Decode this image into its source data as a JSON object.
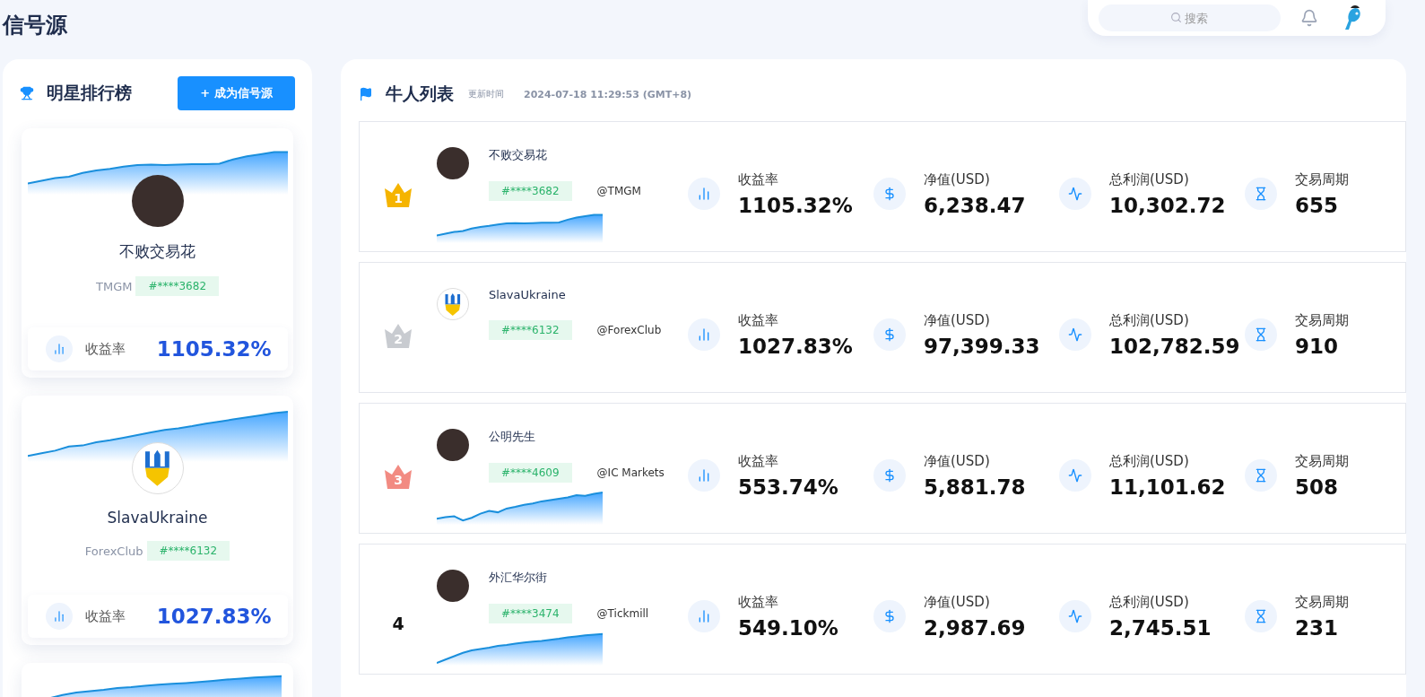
{
  "page_title": "信号源",
  "header": {
    "search": {
      "placeholder": "搜索"
    }
  },
  "star_board": {
    "title": "明星排行榜",
    "button": "+ 成为信号源",
    "cards": [
      {
        "name": "不败交易花",
        "broker": "TMGM",
        "account": "#****3682",
        "metric_label": "收益率",
        "metric_value": "1105.32%",
        "kind": "photo"
      },
      {
        "name": "SlavaUkraine",
        "broker": "ForexClub",
        "account": "#****6132",
        "metric_label": "收益率",
        "metric_value": "1027.83%",
        "kind": "emblem"
      }
    ]
  },
  "trader_list": {
    "title": "牛人列表",
    "updated_label": "更新时间",
    "updated_time": "2024-07-18 11:29:53 (GMT+8)",
    "rows": [
      {
        "rank": "1",
        "color": "#f5b400",
        "name": "不败交易花",
        "account": "#****3682",
        "broker": "@TMGM",
        "kind": "photo",
        "sparkline": true,
        "stats": [
          {
            "kind": "return",
            "label": "收益率",
            "value": "1105.32%"
          },
          {
            "kind": "equity",
            "label": "净值(USD)",
            "value": "6,238.47"
          },
          {
            "kind": "profit",
            "label": "总利润(USD)",
            "value": "10,302.72"
          },
          {
            "kind": "period",
            "label": "交易周期",
            "value": "655"
          }
        ]
      },
      {
        "rank": "2",
        "color": "#c8cbd0",
        "name": "SlavaUkraine",
        "account": "#****6132",
        "broker": "@ForexClub",
        "kind": "emblem",
        "sparkline": false,
        "stats": [
          {
            "kind": "return",
            "label": "收益率",
            "value": "1027.83%"
          },
          {
            "kind": "equity",
            "label": "净值(USD)",
            "value": "97,399.33"
          },
          {
            "kind": "profit",
            "label": "总利润(USD)",
            "value": "102,782.59"
          },
          {
            "kind": "period",
            "label": "交易周期",
            "value": "910"
          }
        ]
      },
      {
        "rank": "3",
        "color": "#f28b82",
        "name": "公明先生",
        "account": "#****4609",
        "broker": "@IC Markets",
        "kind": "photo",
        "sparkline": true,
        "stats": [
          {
            "kind": "return",
            "label": "收益率",
            "value": "553.74%"
          },
          {
            "kind": "equity",
            "label": "净值(USD)",
            "value": "5,881.78"
          },
          {
            "kind": "profit",
            "label": "总利润(USD)",
            "value": "11,101.62"
          },
          {
            "kind": "period",
            "label": "交易周期",
            "value": "508"
          }
        ]
      },
      {
        "rank": "4",
        "name": "外汇华尔街",
        "account": "#****3474",
        "broker": "@Tickmill",
        "kind": "photo",
        "sparkline": true,
        "stats": [
          {
            "kind": "return",
            "label": "收益率",
            "value": "549.10%"
          },
          {
            "kind": "equity",
            "label": "净值(USD)",
            "value": "2,987.69"
          },
          {
            "kind": "profit",
            "label": "总利润(USD)",
            "value": "2,745.51"
          },
          {
            "kind": "period",
            "label": "交易周期",
            "value": "231"
          }
        ]
      }
    ]
  }
}
